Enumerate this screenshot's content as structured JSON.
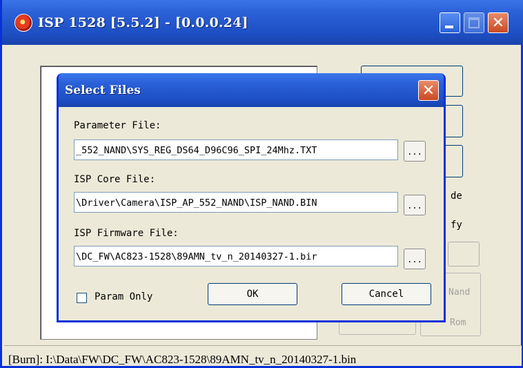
{
  "main_window": {
    "title": "ISP 1528 [5.5.2] - [0.0.0.24]",
    "bg_labels": [
      "de",
      "fy",
      "Nand",
      "Rom"
    ],
    "status_text": "[Burn]: I:\\Data\\FW\\DC_FW\\AC823-1528\\89AMN_tv_n_20140327-1.bin"
  },
  "dialog": {
    "title": "Select Files",
    "parameter_label": "Parameter File:",
    "parameter_value": "_552_NAND\\SYS_REG_DS64_D96C96_SPI_24Mhz.TXT",
    "core_label": "ISP Core File:",
    "core_value": "\\Driver\\Camera\\ISP_AP_552_NAND\\ISP_NAND.BIN",
    "firmware_label": "ISP Firmware File:",
    "firmware_value": "\\DC_FW\\AC823-1528\\89AMN_tv_n_20140327-1.bir",
    "browse_label": "...",
    "param_only_label": "Param Only",
    "param_only_checked": false,
    "ok_label": "OK",
    "cancel_label": "Cancel"
  },
  "colors": {
    "titlebar": "#2a5fd6",
    "close": "#c94a22",
    "face": "#ece9d8"
  }
}
